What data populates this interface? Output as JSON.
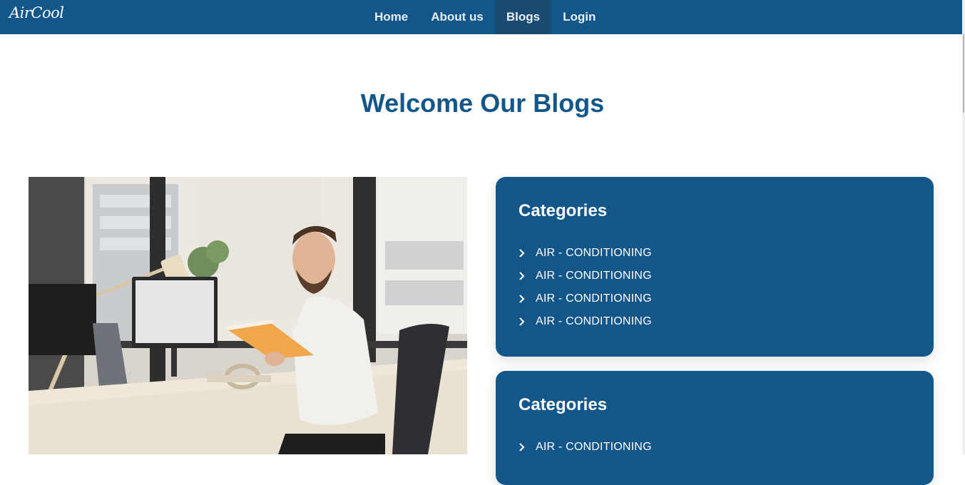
{
  "brand": {
    "logo": "AirCool"
  },
  "nav": {
    "items": [
      {
        "label": "Home",
        "active": false
      },
      {
        "label": "About us",
        "active": false
      },
      {
        "label": "Blogs",
        "active": true
      },
      {
        "label": "Login",
        "active": false
      }
    ]
  },
  "page": {
    "title": "Welcome Our Blogs"
  },
  "image": {
    "icon": "blog-photo-man-reading-at-desk"
  },
  "sidebar": {
    "cards": [
      {
        "title": "Categories",
        "items": [
          "AIR - CONDITIONING",
          "AIR - CONDITIONING",
          "AIR - CONDITIONING",
          "AIR - CONDITIONING"
        ]
      },
      {
        "title": "Categories",
        "items": [
          "AIR - CONDITIONING"
        ]
      }
    ]
  },
  "colors": {
    "brand": "#13568a",
    "active_nav": "#1d4a72",
    "background": "#ffffff"
  }
}
